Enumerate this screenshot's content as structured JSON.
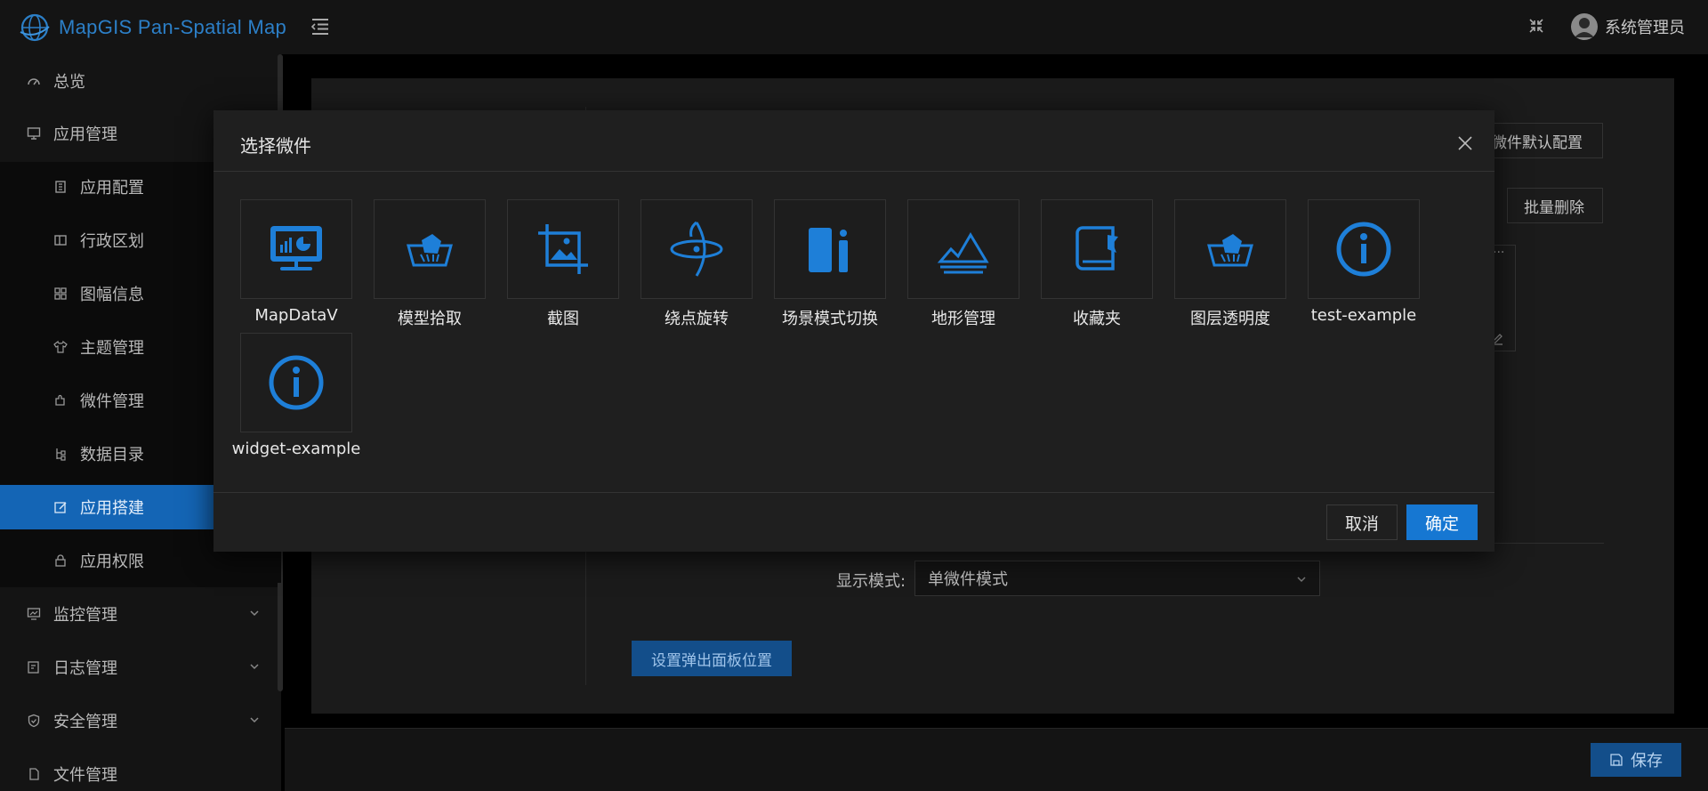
{
  "app": {
    "logo_text": "MapGIS Pan-Spatial Map",
    "accent": "#1677d2"
  },
  "header": {
    "user_name": "系统管理员"
  },
  "sidebar": {
    "items": [
      {
        "label": "总览",
        "icon": "dashboard-icon"
      },
      {
        "label": "应用管理",
        "icon": "monitor-icon"
      },
      {
        "label": "应用配置",
        "icon": "building-icon"
      },
      {
        "label": "行政区划",
        "icon": "split-panel-icon"
      },
      {
        "label": "图幅信息",
        "icon": "grid-icon"
      },
      {
        "label": "主题管理",
        "icon": "shirt-icon"
      },
      {
        "label": "微件管理",
        "icon": "puzzle-icon"
      },
      {
        "label": "数据目录",
        "icon": "tree-icon"
      },
      {
        "label": "应用搭建",
        "icon": "edit-icon"
      },
      {
        "label": "应用权限",
        "icon": "lock-icon"
      },
      {
        "label": "监控管理",
        "icon": "chart-monitor-icon"
      },
      {
        "label": "日志管理",
        "icon": "log-icon"
      },
      {
        "label": "安全管理",
        "icon": "shield-icon"
      },
      {
        "label": "文件管理",
        "icon": "file-icon"
      }
    ]
  },
  "content": {
    "widget_default_config": "微件默认配置",
    "batch_delete": "批量删除",
    "display_mode_label": "显示模式:",
    "display_mode_value": "单微件模式",
    "set_popup_position": "设置弹出面板位置",
    "save": "保存"
  },
  "modal": {
    "title": "选择微件",
    "cancel": "取消",
    "ok": "确定",
    "widgets": [
      {
        "label": "MapDataV",
        "icon": "data-screen-icon"
      },
      {
        "label": "模型拾取",
        "icon": "pick-basket-icon"
      },
      {
        "label": "截图",
        "icon": "crop-image-icon"
      },
      {
        "label": "绕点旋转",
        "icon": "orbit-icon"
      },
      {
        "label": "场景模式切换",
        "icon": "scene-mode-icon"
      },
      {
        "label": "地形管理",
        "icon": "terrain-icon"
      },
      {
        "label": "收藏夹",
        "icon": "bookmark-book-icon"
      },
      {
        "label": "图层透明度",
        "icon": "pick-basket-icon"
      },
      {
        "label": "test-example",
        "icon": "info-circle-icon"
      },
      {
        "label": "widget-example",
        "icon": "info-circle-icon"
      }
    ]
  }
}
